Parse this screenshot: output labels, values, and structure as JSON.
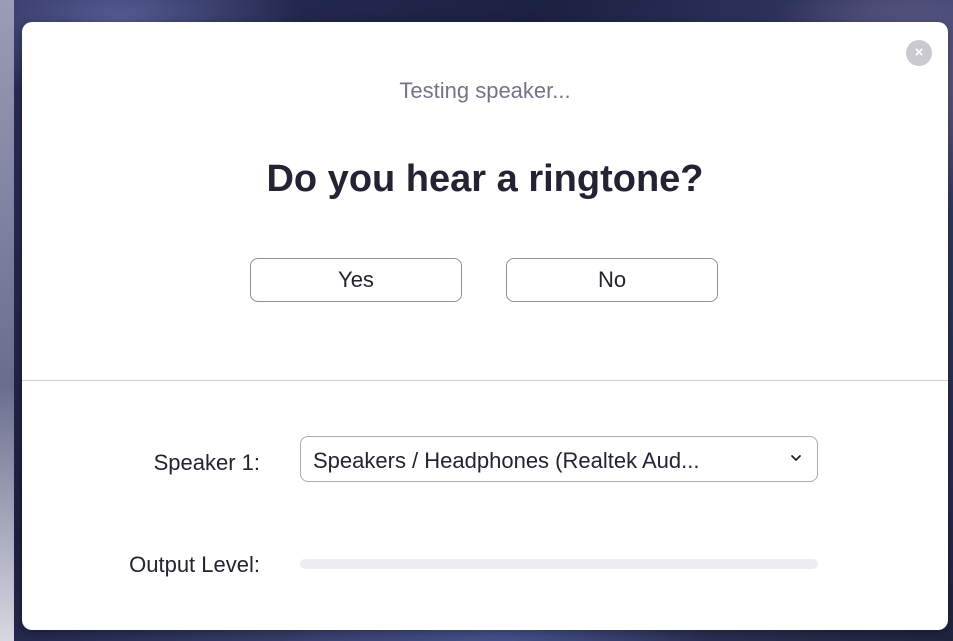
{
  "dialog": {
    "close_symbol": "×",
    "status_text": "Testing speaker...",
    "question": "Do you hear a ringtone?",
    "yes_label": "Yes",
    "no_label": "No"
  },
  "speaker": {
    "label": "Speaker 1:",
    "selected": "Speakers / Headphones (Realtek Aud...",
    "chevron_icon": "chevron-down-icon"
  },
  "output": {
    "label": "Output Level:",
    "level_percent": 0
  },
  "colors": {
    "title_text": "#232333",
    "status_text": "#747487",
    "level_track": "#ededf0",
    "accent": "#2d8cff"
  }
}
